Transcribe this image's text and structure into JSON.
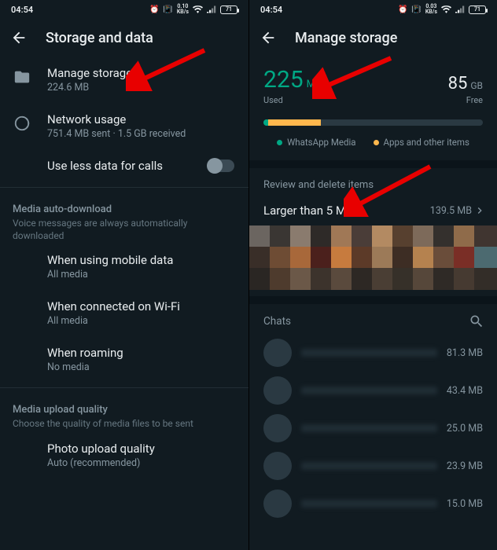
{
  "status": {
    "time": "04:54",
    "net_left": "0.10",
    "net_right": "0.03",
    "net_unit": "KB/s",
    "battery": "71"
  },
  "left": {
    "title": "Storage and data",
    "manage": {
      "label": "Manage storage",
      "sub": "224.6 MB"
    },
    "network": {
      "label": "Network usage",
      "sub": "751.4 MB sent · 1.5 GB received"
    },
    "lessdata": {
      "label": "Use less data for calls"
    },
    "autodl": {
      "header": "Media auto-download",
      "sub": "Voice messages are always automatically downloaded",
      "mobile": {
        "label": "When using mobile data",
        "sub": "All media"
      },
      "wifi": {
        "label": "When connected on Wi-Fi",
        "sub": "All media"
      },
      "roaming": {
        "label": "When roaming",
        "sub": "No media"
      }
    },
    "upload": {
      "header": "Media upload quality",
      "sub": "Choose the quality of media files to be sent",
      "photo": {
        "label": "Photo upload quality",
        "sub": "Auto (recommended)"
      }
    }
  },
  "right": {
    "title": "Manage storage",
    "used": {
      "value": "225",
      "unit": "MB",
      "label": "Used"
    },
    "free": {
      "value": "85",
      "unit": "GB",
      "label": "Free"
    },
    "legend": {
      "a": "WhatsApp Media",
      "b": "Apps and other items"
    },
    "review_header": "Review and delete items",
    "larger": {
      "label": "Larger than 5 MB",
      "size": "139.5 MB"
    },
    "chats_header": "Chats",
    "chats": [
      {
        "size": "81.3 MB"
      },
      {
        "size": "43.4 MB"
      },
      {
        "size": "25.0 MB"
      },
      {
        "size": "23.9 MB"
      },
      {
        "size": "15.0 MB"
      }
    ]
  }
}
